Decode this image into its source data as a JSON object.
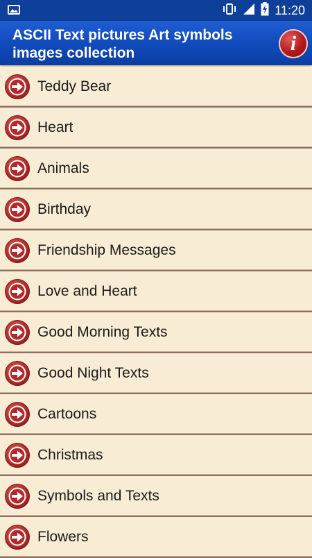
{
  "status_bar": {
    "time": "11:20",
    "icons": [
      "image-notification-icon",
      "vibrate-icon",
      "signal-icon",
      "battery-charging-icon"
    ]
  },
  "app_bar": {
    "title": "ASCII Text pictures Art symbols images collection",
    "info_icon": "info-icon",
    "info_glyph": "i"
  },
  "colors": {
    "status_bar": "#0e3f99",
    "app_bar": "#1552c4",
    "list_background": "#f8ecd4",
    "arrow_icon": "#b22a2a",
    "divider": "#8a7060"
  },
  "categories": [
    {
      "label": "Teddy Bear"
    },
    {
      "label": "Heart"
    },
    {
      "label": "Animals"
    },
    {
      "label": "Birthday"
    },
    {
      "label": "Friendship Messages"
    },
    {
      "label": "Love and Heart"
    },
    {
      "label": "Good Morning Texts"
    },
    {
      "label": "Good Night Texts"
    },
    {
      "label": "Cartoons"
    },
    {
      "label": "Christmas"
    },
    {
      "label": "Symbols and Texts"
    },
    {
      "label": "Flowers"
    }
  ]
}
